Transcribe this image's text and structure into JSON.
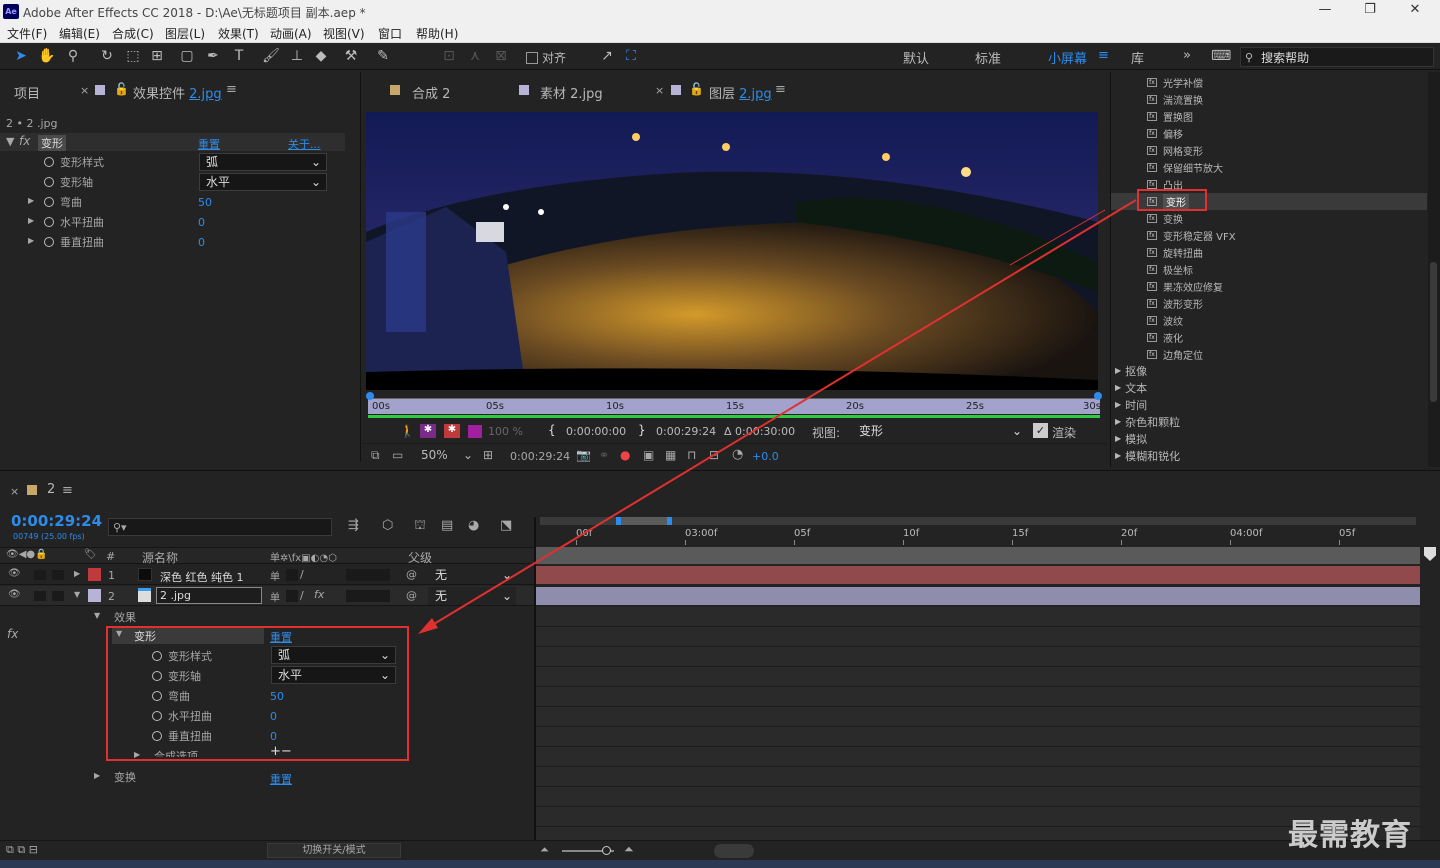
{
  "title": "Adobe After Effects CC 2018 - D:\\Ae\\无标题项目 副本.aep *",
  "app_badge": "Ae",
  "menu": [
    "文件(F)",
    "编辑(E)",
    "合成(C)",
    "图层(L)",
    "效果(T)",
    "动画(A)",
    "视图(V)",
    "窗口",
    "帮助(H)"
  ],
  "toolbar": {
    "snap": "对齐",
    "workspaces": [
      "默认",
      "标准",
      "小屏幕",
      "库"
    ],
    "search_placeholder": "搜索帮助"
  },
  "left_panel": {
    "tab_project": "项目",
    "tab_effects": "效果控件",
    "tab_effects_layer": "2.jpg",
    "breadcrumb": "2 • 2 .jpg",
    "effect_name": "变形",
    "reset": "重置",
    "about": "关于...",
    "props": [
      {
        "label": "变形样式",
        "value": "弧",
        "type": "dd"
      },
      {
        "label": "变形轴",
        "value": "水平",
        "type": "dd"
      },
      {
        "label": "弯曲",
        "value": "50",
        "type": "num"
      },
      {
        "label": "水平扭曲",
        "value": "0",
        "type": "num"
      },
      {
        "label": "垂直扭曲",
        "value": "0",
        "type": "num"
      }
    ]
  },
  "viewer": {
    "tabs": [
      {
        "label": "合成",
        "name": "2"
      },
      {
        "label": "素材",
        "name": "2.jpg"
      },
      {
        "label": "图层",
        "name": "2.jpg"
      }
    ],
    "ruler": [
      "00s",
      "05s",
      "10s",
      "15s",
      "20s",
      "25s",
      "30s"
    ],
    "percent": "100 %",
    "tc_in": "0:00:00:00",
    "tc_out": "0:00:29:24",
    "tc_dur": "Δ 0:00:30:00",
    "view_label": "视图:",
    "view_value": "变形",
    "render": "渲染",
    "zoom": "50%",
    "tc_current": "0:00:29:24",
    "exposure": "+0.0"
  },
  "effects_list": {
    "items": [
      "光学补偿",
      "湍流置换",
      "置换图",
      "偏移",
      "网格变形",
      "保留细节放大",
      "凸出",
      "变形",
      "变换",
      "变形稳定器 VFX",
      "旋转扭曲",
      "极坐标",
      "果冻效应修复",
      "波形变形",
      "波纹",
      "液化",
      "边角定位"
    ],
    "selected_index": 7,
    "categories": [
      "抠像",
      "文本",
      "时间",
      "杂色和颗粒",
      "模拟",
      "模糊和锐化"
    ]
  },
  "timeline": {
    "comp_name": "2",
    "timecode": "0:00:29:24",
    "frames": "00749 (25.00 fps)",
    "search_placeholder": "",
    "col_source": "源名称",
    "col_parent": "父级",
    "layers": [
      {
        "index": "1",
        "name": "深色 红色 纯色 1",
        "parent": "无",
        "color": "#c0393c"
      },
      {
        "index": "2",
        "name": "2 .jpg",
        "parent": "无",
        "color": "#b6b3d7"
      }
    ],
    "effects_group": "效果",
    "effect_name": "变形",
    "reset": "重置",
    "props": [
      {
        "label": "变形样式",
        "value": "弧",
        "type": "dd"
      },
      {
        "label": "变形轴",
        "value": "水平",
        "type": "dd"
      },
      {
        "label": "弯曲",
        "value": "50",
        "type": "num"
      },
      {
        "label": "水平扭曲",
        "value": "0",
        "type": "num"
      },
      {
        "label": "垂直扭曲",
        "value": "0",
        "type": "num"
      }
    ],
    "composite": "合成选项",
    "composite_ctrl": "+−",
    "transform": "变换",
    "transform_reset": "重置",
    "ruler": [
      "00f",
      "03:00f",
      "05f",
      "10f",
      "15f",
      "20f",
      "04:00f",
      "05f"
    ],
    "toggle_label": "切换开关/模式"
  },
  "watermark": "最需教育"
}
